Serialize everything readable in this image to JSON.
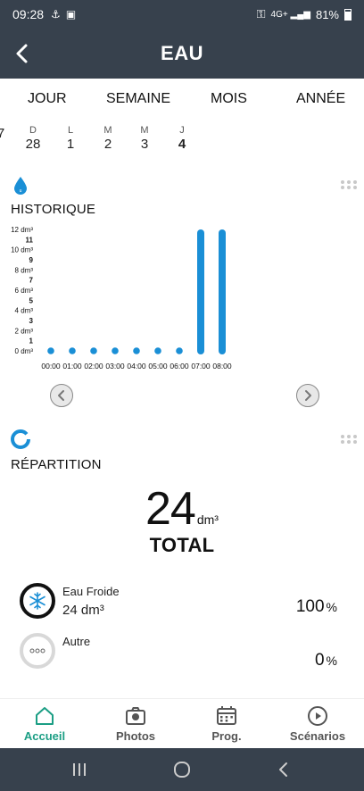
{
  "status_bar": {
    "time": "09:28",
    "network": "4G+",
    "battery": "81%"
  },
  "header": {
    "title": "EAU"
  },
  "period_tabs": [
    "JOUR",
    "SEMAINE",
    "MOIS",
    "ANNÉE"
  ],
  "days": [
    {
      "letter": "",
      "num": "7"
    },
    {
      "letter": "D",
      "num": "28"
    },
    {
      "letter": "L",
      "num": "1"
    },
    {
      "letter": "M",
      "num": "2"
    },
    {
      "letter": "M",
      "num": "3"
    },
    {
      "letter": "J",
      "num": "4"
    }
  ],
  "historique": {
    "title": "HISTORIQUE"
  },
  "chart_data": {
    "type": "bar",
    "title": "",
    "ylabel": "",
    "xlabel": "",
    "y_unit": "dm³",
    "ylim": [
      0,
      12
    ],
    "y_ticks": [
      "12 dm³",
      "11",
      "10 dm³",
      "9",
      "8 dm³",
      "7",
      "6 dm³",
      "5",
      "4 dm³",
      "3",
      "2 dm³",
      "1",
      "0 dm³"
    ],
    "categories": [
      "00:00",
      "01:00",
      "02:00",
      "03:00",
      "04:00",
      "05:00",
      "06:00",
      "07:00",
      "08:00"
    ],
    "values": [
      0,
      0,
      0,
      0,
      0,
      0,
      0,
      12,
      12
    ],
    "grid": false,
    "color": "#1a8fd6"
  },
  "repartition": {
    "title": "RÉPARTITION",
    "total_value": "24",
    "total_unit": "dm³",
    "total_label": "TOTAL",
    "items": [
      {
        "name": "Eau Froide",
        "value": "24 dm³",
        "pct": "100",
        "pct_unit": "%"
      },
      {
        "name": "Autre",
        "value": "",
        "pct": "0",
        "pct_unit": "%"
      }
    ]
  },
  "bottom_nav": [
    {
      "label": "Accueil",
      "icon": "home-icon",
      "active": true
    },
    {
      "label": "Photos",
      "icon": "camera-icon",
      "active": false
    },
    {
      "label": "Prog.",
      "icon": "calendar-icon",
      "active": false
    },
    {
      "label": "Scénarios",
      "icon": "play-circle-icon",
      "active": false
    }
  ],
  "colors": {
    "header_bg": "#37414d",
    "accent": "#1b9e84",
    "water_blue": "#1a8fd6"
  }
}
